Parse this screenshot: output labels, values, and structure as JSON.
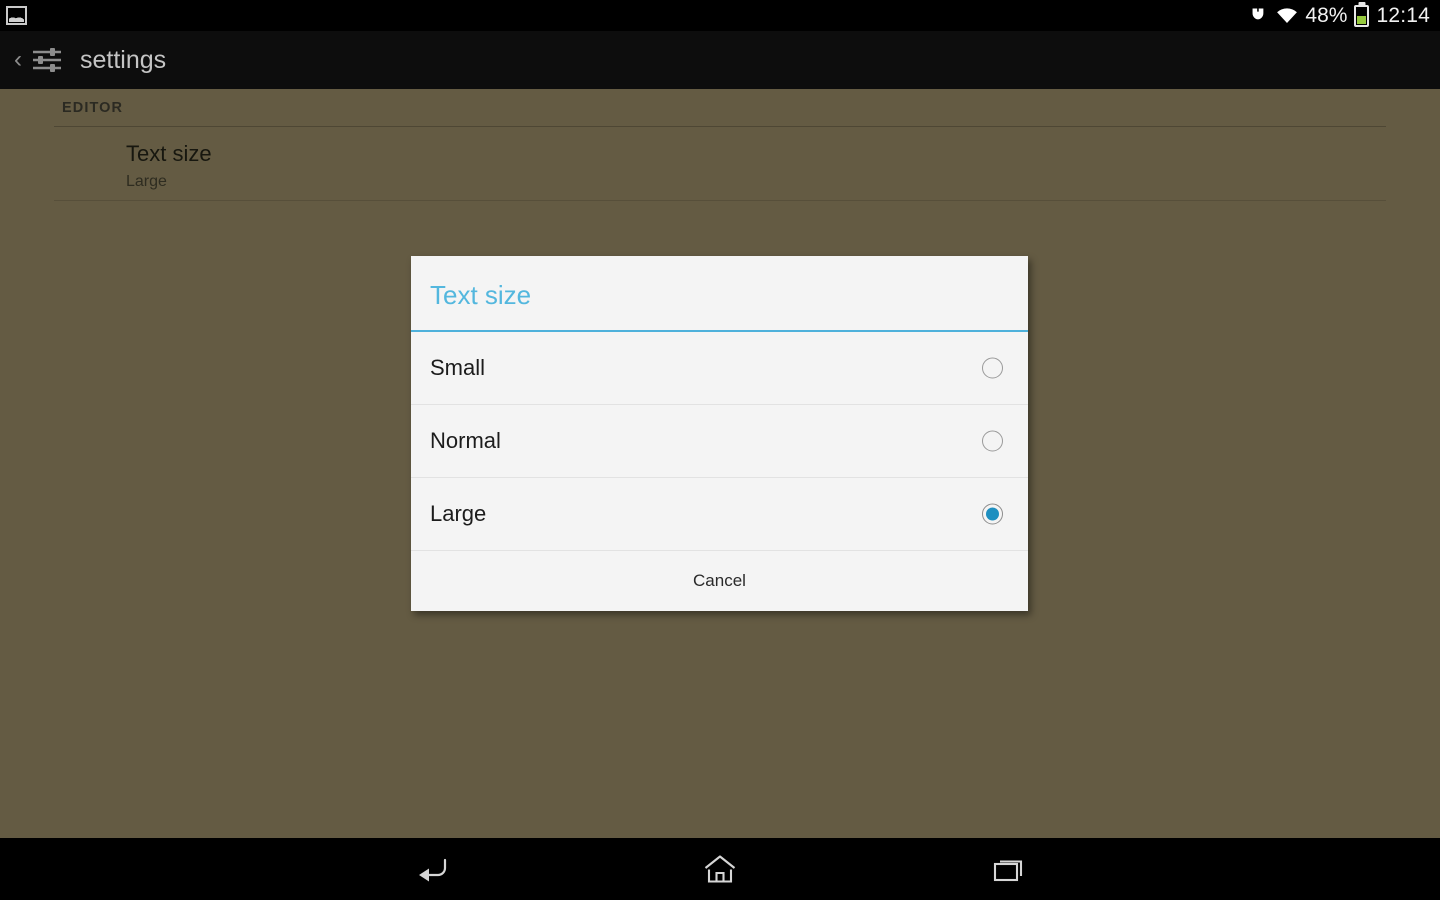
{
  "status_bar": {
    "notification_icon": "photo-icon",
    "vpn_icon": "vpn-key-icon",
    "wifi_icon": "wifi-icon",
    "battery_percent": "48%",
    "battery_icon": "battery-icon",
    "battery_level": 50,
    "time": "12:14"
  },
  "action_bar": {
    "back_icon": "back-chevron-icon",
    "app_icon": "sliders-settings-icon",
    "title": "settings"
  },
  "settings": {
    "section_header": "EDITOR",
    "items": [
      {
        "title": "Text size",
        "summary": "Large"
      }
    ]
  },
  "dialog": {
    "title": "Text size",
    "options": [
      {
        "label": "Small",
        "selected": false
      },
      {
        "label": "Normal",
        "selected": false
      },
      {
        "label": "Large",
        "selected": true
      }
    ],
    "cancel_label": "Cancel"
  },
  "nav_bar": {
    "back_icon": "nav-back-icon",
    "home_icon": "nav-home-icon",
    "recents_icon": "nav-recents-icon"
  },
  "colors": {
    "background": "#645b43",
    "accent": "#4eb1db",
    "title_blue": "#53b7de",
    "radio_selected": "#1e8fc0",
    "battery_green": "#96c93d",
    "bar_black": "#0d0d0d"
  }
}
